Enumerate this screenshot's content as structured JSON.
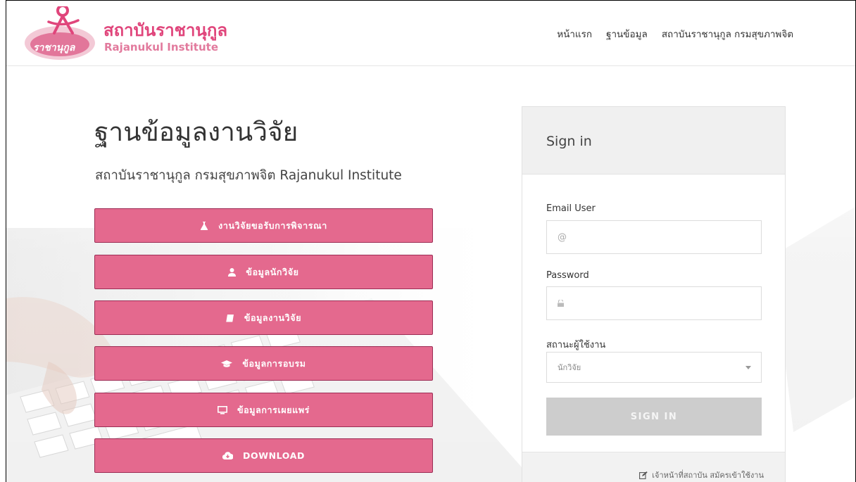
{
  "header": {
    "logo_title_th": "สถาบันราชานุกูล",
    "logo_title_en": "Rajanukul Institute",
    "logo_mark_text": "ราชานุกูล",
    "nav": [
      {
        "label": "หน้าแรก"
      },
      {
        "label": "ฐานข้อมูล"
      },
      {
        "label": "สถาบันราชานุกูล กรมสุขภาพจิต"
      }
    ]
  },
  "main": {
    "title": "ฐานข้อมูลงานวิจัย",
    "subtitle": "สถาบันราชานุกูล กรมสุขภาพจิต Rajanukul Institute",
    "buttons": [
      {
        "label": "งานวิจัยขอรับการพิจารณา",
        "icon": "flask-icon"
      },
      {
        "label": "ข้อมูลนักวิจัย",
        "icon": "user-icon"
      },
      {
        "label": "ข้อมูลงานวิจัย",
        "icon": "book-icon"
      },
      {
        "label": "ข้อมูลการอบรม",
        "icon": "graduation-cap-icon"
      },
      {
        "label": "ข้อมูลการเผยแพร่",
        "icon": "monitor-icon"
      },
      {
        "label": "DOWNLOAD",
        "icon": "cloud-download-icon"
      }
    ]
  },
  "signin": {
    "heading": "Sign in",
    "email_label": "Email User",
    "email_placeholder": "@",
    "password_label": "Password",
    "status_label": "สถานะผู้ใช้งาน",
    "status_selected": "นักวิจัย",
    "submit_label": "SIGN IN",
    "footer_link": "เจ้าหน้าที่สถาบัน สมัครเข้าใช้งาน"
  },
  "colors": {
    "accent": "#e4698e",
    "accent_border": "#9c2d55",
    "brand_text": "#e0457b",
    "signin_disabled": "#cdcdcd"
  }
}
